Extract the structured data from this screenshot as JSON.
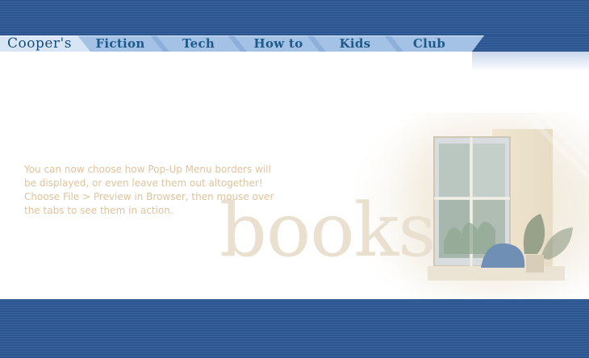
{
  "nav": {
    "home": "Cooper's",
    "tabs": [
      {
        "label": "Fiction"
      },
      {
        "label": "Tech"
      },
      {
        "label": "How to"
      },
      {
        "label": "Kids"
      },
      {
        "label": "Club"
      }
    ]
  },
  "hero": {
    "watermark": "books"
  },
  "intro": {
    "lines": [
      "You can now choose how Pop-Up Menu borders will",
      "be displayed, or even leave them out altogether!",
      "Choose File > Preview in Browser, then mouse over",
      "the tabs to see them in action."
    ]
  },
  "colors": {
    "band": "#2c5590",
    "tab": "#a4c2e6",
    "tab_text": "#1d5a8a",
    "intro_text": "#e0c49c",
    "watermark": "#eae0d0"
  }
}
